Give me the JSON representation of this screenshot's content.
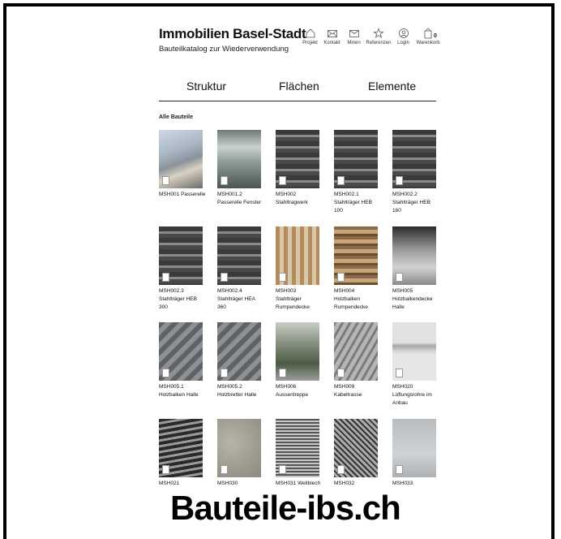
{
  "header": {
    "title": "Immobilien Basel-Stadt",
    "subtitle": "Bauteilkatalog zur Wiederverwendung",
    "nav": [
      {
        "label": "Projekt",
        "icon": "house-icon"
      },
      {
        "label": "Kontakt",
        "icon": "envelope-icon"
      },
      {
        "label": "Minen",
        "icon": "mail-open-icon"
      },
      {
        "label": "Referenzen",
        "icon": "star-icon"
      },
      {
        "label": "Login",
        "icon": "user-icon"
      },
      {
        "label": "Warenkorb",
        "icon": "bag-icon"
      }
    ],
    "cart_count": "0"
  },
  "tabs": [
    "Struktur",
    "Flächen",
    "Elemente"
  ],
  "section_label": "Alle Bauteile",
  "items": [
    {
      "id": "MSH001",
      "lines": [
        "MSH001 Passerelle"
      ],
      "style": "passerelle"
    },
    {
      "id": "MSH001.2",
      "lines": [
        "MSH001.2",
        "Passerelle Fenster"
      ],
      "style": "window"
    },
    {
      "id": "MSH002",
      "lines": [
        "MSH002",
        "Stahltragwerk"
      ],
      "style": "steel"
    },
    {
      "id": "MSH002.1",
      "lines": [
        "MSH002.1",
        "Stahlträger HEB",
        "100"
      ],
      "style": "steel"
    },
    {
      "id": "MSH002.2",
      "lines": [
        "MSH002.2",
        "Stahlträger HEB",
        "160"
      ],
      "style": "steel"
    },
    {
      "id": "MSH002.3",
      "lines": [
        "MSH002.3",
        "Stahlträger HEB",
        "300"
      ],
      "style": "steel"
    },
    {
      "id": "MSH002.4",
      "lines": [
        "MSH002.4",
        "Stahlträger HEA",
        "360"
      ],
      "style": "steel"
    },
    {
      "id": "MSH003",
      "lines": [
        "MSH003",
        "Stahlträger",
        "Rumpendecke"
      ],
      "style": "beams"
    },
    {
      "id": "MSH004",
      "lines": [
        "MSH004",
        "Holzbalken",
        "Rumpendecke"
      ],
      "style": "wood"
    },
    {
      "id": "MSH005",
      "lines": [
        "MSH005",
        "Holzbalkendecke",
        "Halle"
      ],
      "style": "hall"
    },
    {
      "id": "MSH005.1",
      "lines": [
        "MSH005.1",
        "Holzbalken Halle"
      ],
      "style": "grey"
    },
    {
      "id": "MSH005.2",
      "lines": [
        "MSH005.2",
        "Holzbretter Halle"
      ],
      "style": "grey"
    },
    {
      "id": "MSH006",
      "lines": [
        "MSH006",
        "Aussentreppe"
      ],
      "style": "stairs"
    },
    {
      "id": "MSH009",
      "lines": [
        "MSH009",
        "Kabeltrasse"
      ],
      "style": "cable"
    },
    {
      "id": "MSH020",
      "lines": [
        "MSH020",
        "Lüftungsrohre im",
        "Anbau"
      ],
      "style": "pipe"
    },
    {
      "id": "MSH021",
      "lines": [
        "MSH021"
      ],
      "style": "slats"
    },
    {
      "id": "MSH030",
      "lines": [
        "MSH030"
      ],
      "style": "stone"
    },
    {
      "id": "MSH031",
      "lines": [
        "MSH031 Wellblech"
      ],
      "style": "corrugated"
    },
    {
      "id": "MSH032",
      "lines": [
        "MSH032"
      ],
      "style": "mesh"
    },
    {
      "id": "MSH033",
      "lines": [
        "MSH033"
      ],
      "style": "panel"
    }
  ],
  "watermark": "Bauteile-ibs.ch"
}
